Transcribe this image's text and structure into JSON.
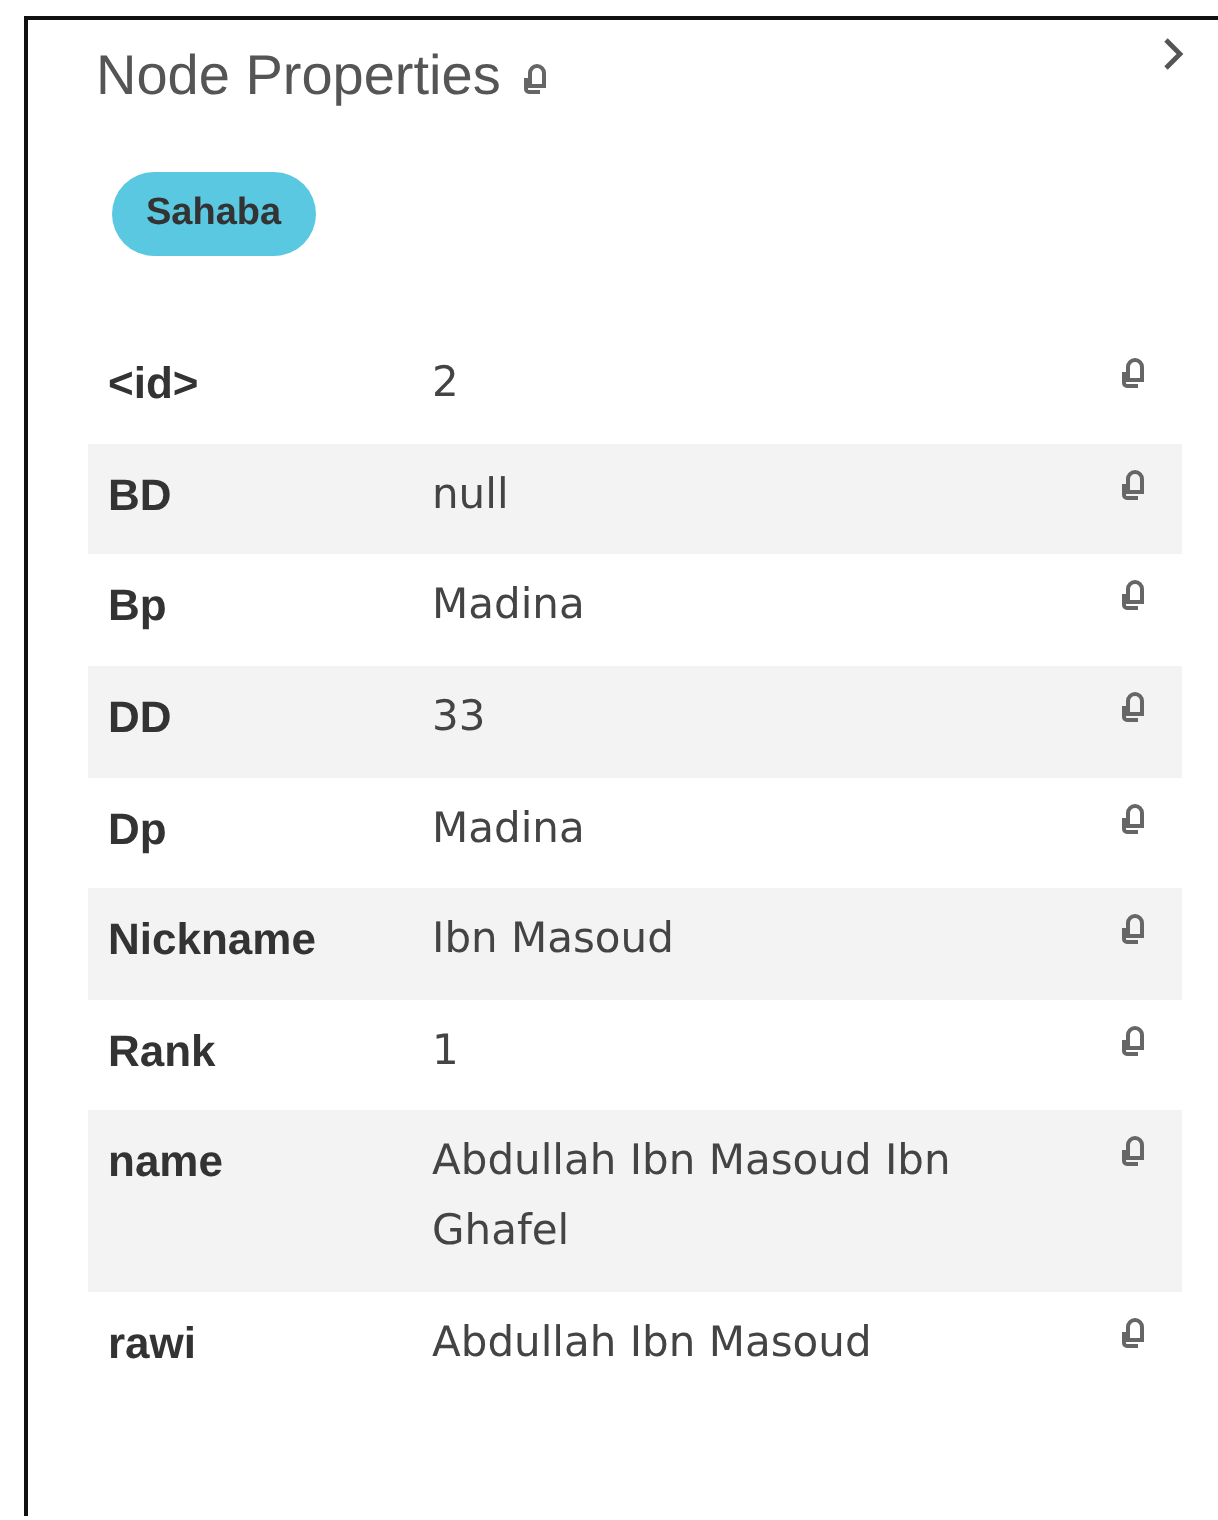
{
  "panel": {
    "title": "Node Properties"
  },
  "label": "Sahaba",
  "properties": [
    {
      "key": "<id>",
      "value": "2"
    },
    {
      "key": "BD",
      "value": "null"
    },
    {
      "key": "Bp",
      "value": "Madina"
    },
    {
      "key": "DD",
      "value": "33"
    },
    {
      "key": "Dp",
      "value": "Madina"
    },
    {
      "key": "Nickname",
      "value": "Ibn Masoud"
    },
    {
      "key": "Rank",
      "value": "1"
    },
    {
      "key": "name",
      "value": "Abdullah Ibn Masoud Ibn Ghafel"
    },
    {
      "key": "rawi",
      "value": "Abdullah Ibn Masoud"
    }
  ]
}
